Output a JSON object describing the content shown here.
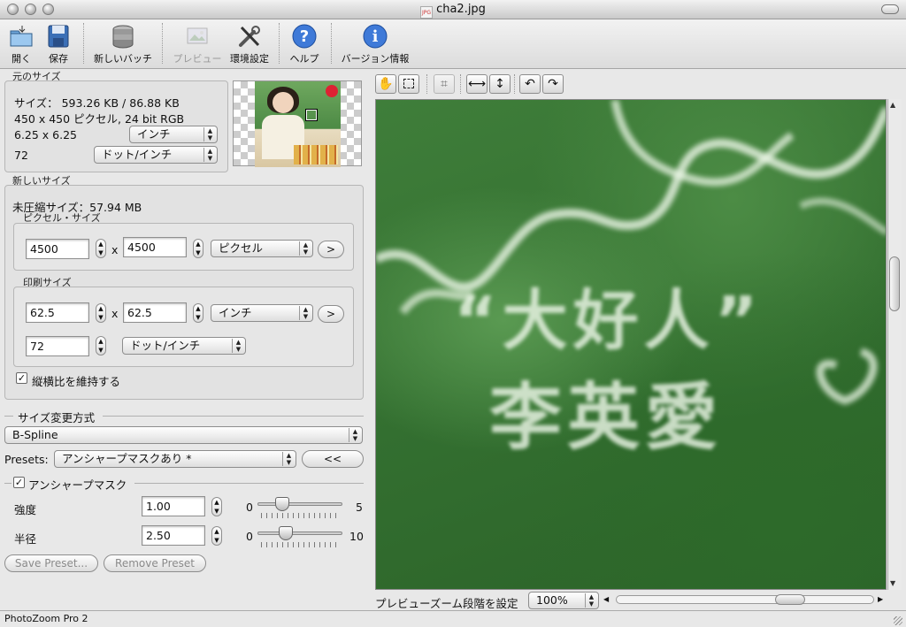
{
  "window": {
    "title": "cha2.jpg",
    "file_badge": "JPG"
  },
  "toolbar": {
    "open": "開く",
    "save": "保存",
    "new_batch": "新しいバッチ",
    "preview": "プレビュー",
    "preferences": "環境設定",
    "help": "ヘルプ",
    "version_info": "バージョン情報"
  },
  "original": {
    "group_label": "元のサイズ",
    "size_line": "サイズ： 593.26 KB / 86.88 KB",
    "pixels_line": "450 x 450 ピクセル, 24 bit RGB",
    "dimensions": "6.25 x 6.25",
    "unit": "インチ",
    "resolution": "72",
    "res_unit": "ドット/インチ"
  },
  "new_size": {
    "group_label": "新しいサイズ",
    "uncompressed": "未圧縮サイズ：57.94 MB",
    "pixel_group": "ピクセル・サイズ",
    "width_px": "4500",
    "height_px": "4500",
    "pixel_unit": "ピクセル",
    "print_group": "印刷サイズ",
    "width_print": "62.5",
    "height_print": "62.5",
    "print_unit": "インチ",
    "resolution": "72",
    "res_unit": "ドット/インチ",
    "times": "x",
    "arrow_btn": ">",
    "keep_ratio": "縦横比を維持する"
  },
  "resize": {
    "group_label": "サイズ変更方式",
    "method": "B-Spline",
    "presets_label": "Presets:",
    "preset_value": "アンシャープマスクあり *",
    "collapse_btn": "<<"
  },
  "unsharp": {
    "label": "アンシャープマスク",
    "strength_label": "強度",
    "strength_value": "1.00",
    "strength_min": "0",
    "strength_max": "5",
    "strength_level": 0.2,
    "radius_label": "半径",
    "radius_value": "2.50",
    "radius_min": "0",
    "radius_max": "10",
    "radius_level": 0.25
  },
  "buttons": {
    "save_preset": "Save Preset...",
    "remove_preset": "Remove Preset"
  },
  "preview": {
    "zoom_label": "プレビューズーム段階を設定",
    "zoom_value": "100%",
    "image_text_line1": "“大好人”",
    "image_text_line2": "李英愛"
  },
  "status": {
    "app_name": "PhotoZoom Pro 2"
  },
  "colors": {
    "preview_green": "#3f7e3a",
    "help_blue": "#2f6fd0"
  }
}
